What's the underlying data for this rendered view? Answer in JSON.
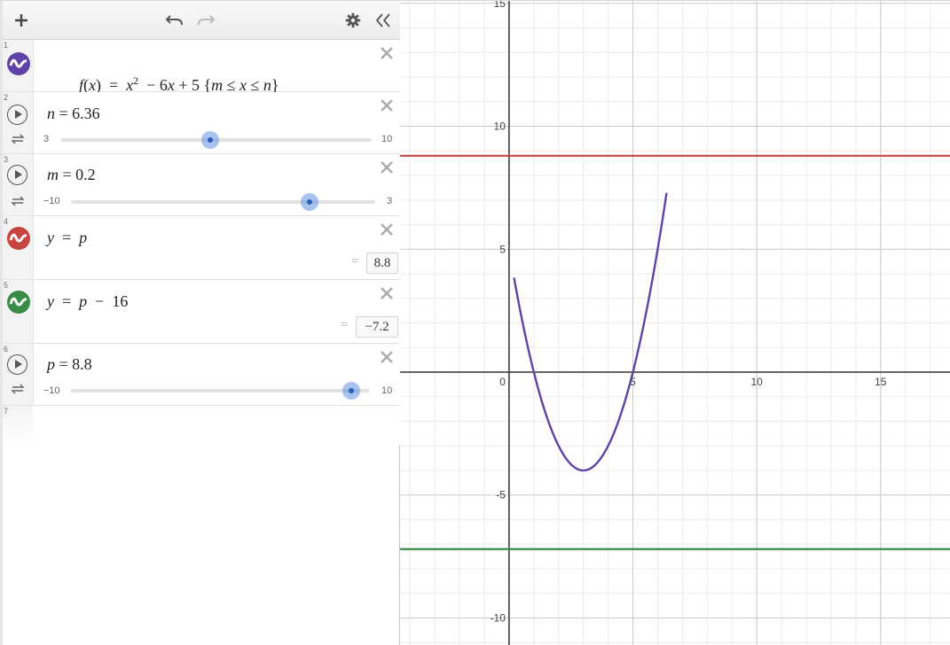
{
  "toolbar": {
    "add_icon": "plus-icon",
    "undo_icon": "undo-icon",
    "redo_icon": "redo-icon",
    "settings_icon": "gear-icon",
    "collapse_icon": "double-chevron-left-icon"
  },
  "expressions": [
    {
      "index": "1",
      "type": "function",
      "color": "#6042a6",
      "f": "f",
      "x": "x",
      "eq": "=",
      "sq": "2",
      "rest": "− 6",
      "rest2": " + 5",
      "brace_open": "{",
      "m": "m",
      "le": "≤",
      "xv": "x",
      "le2": "≤",
      "n": "n",
      "brace_close": "}"
    },
    {
      "index": "2",
      "type": "slider",
      "var": "n",
      "eq": "=",
      "value": "6.36",
      "min": "3",
      "max": "10",
      "fraction": 0.48
    },
    {
      "index": "3",
      "type": "slider",
      "var": "m",
      "eq": "=",
      "value": "0.2",
      "min": "−10",
      "max": "3",
      "fraction": 0.785
    },
    {
      "index": "4",
      "type": "line",
      "color": "#c74440",
      "lhs": "y",
      "eq": "=",
      "rhs": "p",
      "result_eq": "=",
      "result": "8.8"
    },
    {
      "index": "5",
      "type": "line",
      "color": "#388c46",
      "lhs": "y",
      "eq": "=",
      "rhs": "p",
      "minus": "−",
      "num": "16",
      "result_eq": "=",
      "result": "−7.2"
    },
    {
      "index": "6",
      "type": "slider",
      "var": "p",
      "eq": "=",
      "value": "8.8",
      "min": "−10",
      "max": "10",
      "fraction": 0.94
    },
    {
      "index": "7",
      "type": "empty"
    }
  ],
  "graph": {
    "x_ticks": [
      "0",
      "5",
      "10",
      "15"
    ],
    "y_ticks": [
      "15",
      "10",
      "5",
      "-5",
      "-10"
    ],
    "colors": {
      "curve": "#6042a6",
      "line_p": "#c74440",
      "line_p16": "#388c46",
      "axis": "#333333",
      "grid_major": "#c9c9c9",
      "grid_minor": "#ececec"
    },
    "xmin": -4.4,
    "xmax": 17.8,
    "ymin": -11.1,
    "ymax": 15.1,
    "function": {
      "a": 1,
      "b": -6,
      "c": 5,
      "domain": [
        0.2,
        6.36
      ]
    },
    "line_p_value": 8.8,
    "line_p16_value": -7.2
  }
}
